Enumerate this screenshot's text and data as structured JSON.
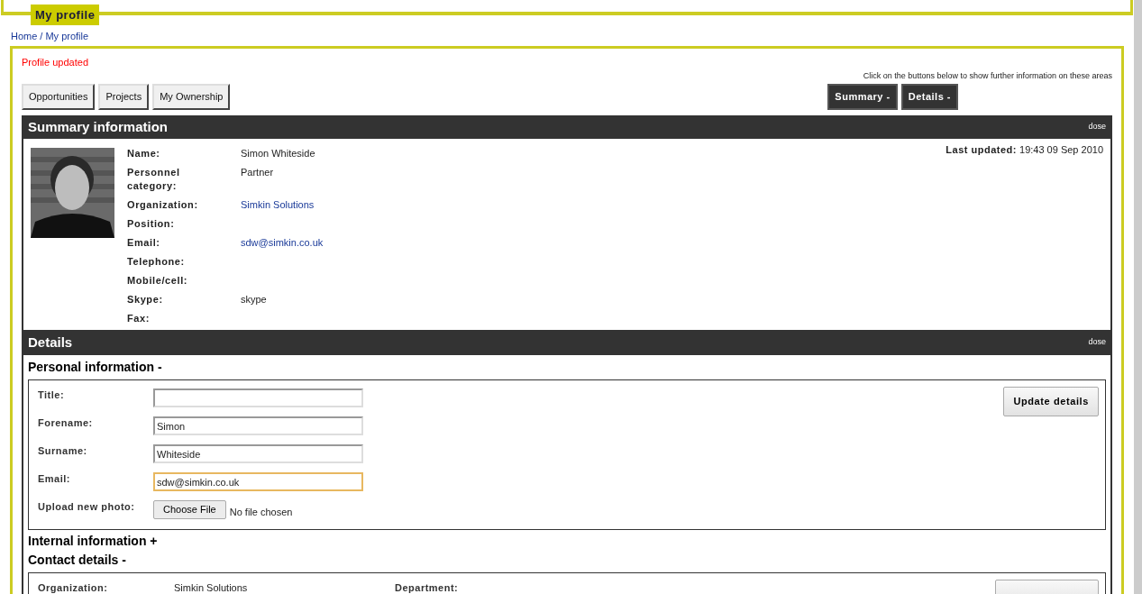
{
  "header": {
    "tab": "My profile"
  },
  "breadcrumb": {
    "separator": "/",
    "items": [
      {
        "label": "Home"
      },
      {
        "label": "My profile"
      }
    ]
  },
  "message": "Profile updated",
  "nav_buttons": [
    "Opportunities",
    "Projects",
    "My Ownership"
  ],
  "hint": "Click on the buttons below to show further information on these areas",
  "toggle_buttons": [
    "Summary -",
    "Details -"
  ],
  "summary": {
    "title": "Summary information",
    "close": "dose",
    "last_updated_label": "Last updated:",
    "last_updated": "19:43 09 Sep 2010",
    "fields": [
      {
        "label": "Name:",
        "value": "Simon Whiteside",
        "link": false
      },
      {
        "label": "Personnel category:",
        "value": "Partner",
        "link": false
      },
      {
        "label": "Organization:",
        "value": "Simkin Solutions",
        "link": true
      },
      {
        "label": "Position:"
      },
      {
        "label": "Email:",
        "value": "sdw@simkin.co.uk",
        "link": true
      },
      {
        "label": "Telephone:"
      },
      {
        "label": "Mobile/cell:"
      },
      {
        "label": "Skype:",
        "value": "skype",
        "link": false
      },
      {
        "label": "Fax:"
      }
    ]
  },
  "details": {
    "title": "Details",
    "close": "dose",
    "sections": [
      {
        "title": "Personal information -",
        "expanded": true,
        "kind": "form",
        "button": "Update details",
        "fields": [
          {
            "label": "Title:",
            "kind": "text",
            "focused": false
          },
          {
            "label": "Forename:",
            "kind": "text",
            "value": "Simon",
            "focused": false
          },
          {
            "label": "Surname:",
            "kind": "text",
            "value": "Whiteside",
            "focused": false
          },
          {
            "label": "Email:",
            "kind": "text",
            "value": "sdw@simkin.co.uk",
            "focused": true
          },
          {
            "label": "Upload new photo:",
            "kind": "file",
            "button": "Choose File",
            "status": "No file chosen"
          }
        ]
      },
      {
        "title": "Internal information +",
        "expanded": false
      },
      {
        "title": "Contact details -",
        "expanded": true,
        "kind": "grid",
        "fields": [
          {
            "label": "Organization:",
            "value": "Simkin Solutions"
          },
          {
            "label": "Department:"
          }
        ]
      }
    ]
  }
}
